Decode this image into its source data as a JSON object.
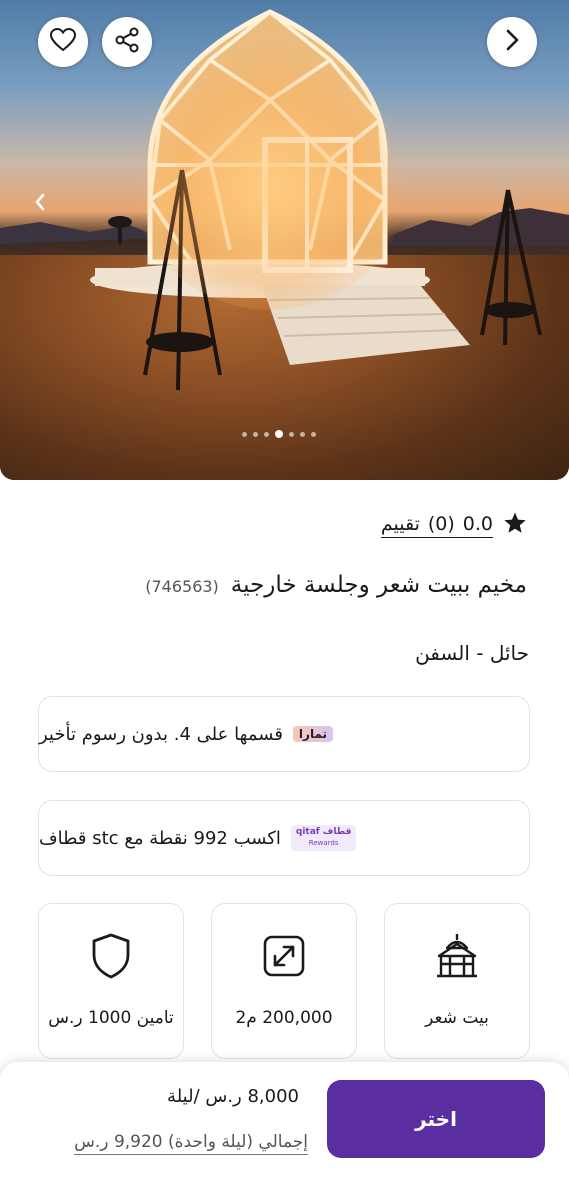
{
  "hero": {
    "image_alt": "Illuminated geodesic dome tent in desert at dusk",
    "active_slide": 4,
    "slide_count": 7
  },
  "icons": {
    "favorite": "heart-icon",
    "share": "share-icon",
    "next": "chevron-right-icon",
    "prev": "chevron-left-icon",
    "rating_star": "star-icon",
    "insurance": "shield-icon",
    "area": "expand-arrows-icon",
    "type": "tent-house-icon"
  },
  "rating": {
    "score": "0.0",
    "count": "(0)",
    "label": "تقييم"
  },
  "listing": {
    "title": "مخيم ببيت شعر وجلسة خارجية",
    "id": "(746563)",
    "location": "حائل - السفن"
  },
  "promos": {
    "tamara": {
      "logo": "تمارا",
      "text": "قسمها على 4. بدون رسوم تأخير"
    },
    "qitaf": {
      "logo_line1": "قطاف qitaf",
      "logo_line2": "Rewards",
      "text": "اكسب 992 نقطة مع stc قطاف"
    }
  },
  "features": {
    "type": "بيت شعر",
    "area": "200,000 م2",
    "insurance": "تامين 1000 ر.س"
  },
  "booking": {
    "price": "8,000 ر.س /ليلة",
    "total": "إجمالي (ليلة واحدة) 9,920 ر.س",
    "select_label": "اختر"
  },
  "colors": {
    "accent": "#5a2da0",
    "border": "#e2e2e2",
    "text": "#1a1a1a"
  }
}
